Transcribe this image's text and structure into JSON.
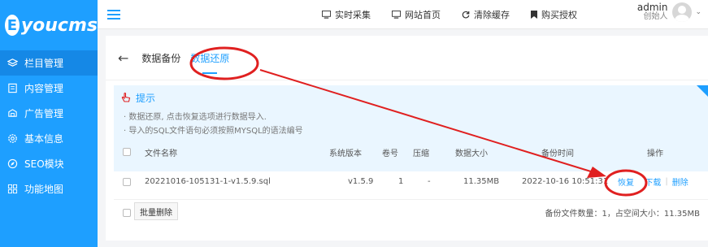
{
  "logo": {
    "letter": "E",
    "text": "youcms"
  },
  "sidebar": {
    "items": [
      {
        "label": "栏目管理",
        "icon": "layers-icon",
        "active": true
      },
      {
        "label": "内容管理",
        "icon": "document-icon"
      },
      {
        "label": "广告管理",
        "icon": "ad-icon"
      },
      {
        "label": "基本信息",
        "icon": "gear-icon"
      },
      {
        "label": "SEO模块",
        "icon": "compass-icon"
      },
      {
        "label": "功能地图",
        "icon": "grid-icon"
      }
    ]
  },
  "topbar": {
    "links": [
      {
        "label": "实时采集",
        "icon": "monitor-icon"
      },
      {
        "label": "网站首页",
        "icon": "monitor-icon"
      },
      {
        "label": "清除缓存",
        "icon": "refresh-icon"
      },
      {
        "label": "购买授权",
        "icon": "bookmark-icon"
      }
    ],
    "user": {
      "name": "admin",
      "role": "创始人"
    }
  },
  "tabs": {
    "back": "←",
    "items": [
      "数据备份",
      "数据还原"
    ],
    "active": 1
  },
  "tip": {
    "title": "提示",
    "lines": [
      "· 数据还原, 点击恢复选项进行数据导入.",
      "· 导入的SQL文件语句必须按照MYSQL的语法编号"
    ]
  },
  "table": {
    "headers": [
      "文件名称",
      "系统版本",
      "卷号",
      "压缩",
      "数据大小",
      "备份时间",
      "操作"
    ],
    "rows": [
      {
        "name": "20221016-105131-1-v1.5.9.sql",
        "version": "v1.5.9",
        "volume": "1",
        "compress": "-",
        "size": "11.35MB",
        "time": "2022-10-16 10:51:31",
        "ops": [
          "恢复",
          "下载",
          "删除"
        ]
      }
    ]
  },
  "footer": {
    "batch_delete": "批量删除",
    "summary": "备份文件数量：1，占空间大小：11.35MB"
  },
  "colors": {
    "accent": "#1e9fff",
    "annotation": "#e02020",
    "tip_bg": "#eaf6ff"
  }
}
